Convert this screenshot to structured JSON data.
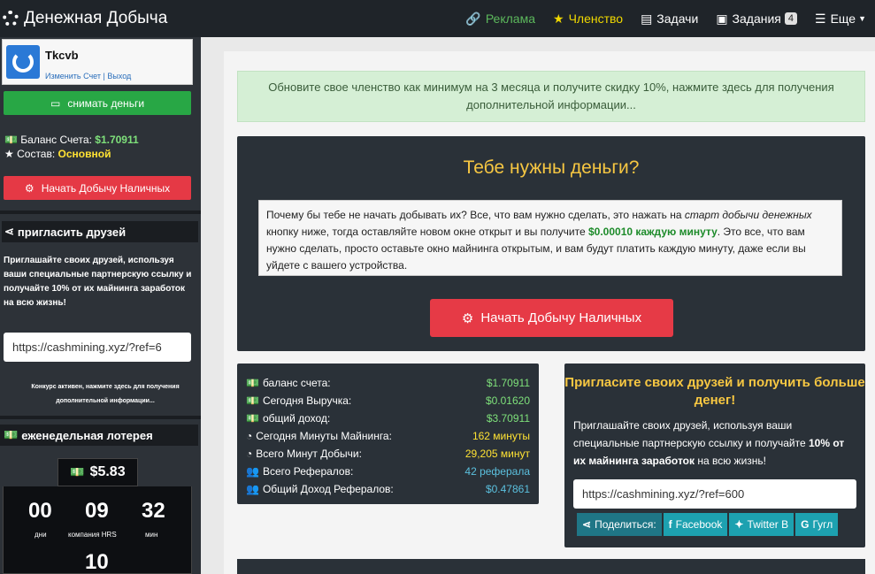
{
  "app": {
    "title": "Денежная Добыча"
  },
  "nav": {
    "ads": "Реклама",
    "membership": "Членство",
    "tasks": "Задачи",
    "jobs": "Задания",
    "jobs_count": "4",
    "more": "Еще"
  },
  "colors": {
    "green": "#28a745",
    "red": "#e53945",
    "gold": "#f7c742",
    "dark": "#2a3138"
  },
  "sidebar": {
    "username": "Tkcvb",
    "links": "Изменить Счет | Выход",
    "withdraw": "снимать деньги",
    "balance_label": "Баланс Счета:",
    "balance_value": "$1.70911",
    "status_label": "Состав:",
    "status_value": "Основной",
    "start_button": "Начать Добычу Наличных",
    "invite_title": "пригласить друзей",
    "invite_text_1": "Приглашайте своих друзей, используя ваши специальные партнерскую ссылку и получайте ",
    "invite_text_bold": "10% от их майнинга заработок",
    "invite_text_2": " на всю жизнь!",
    "ref_link": "https://cashmining.xyz/?ref=6",
    "contest": "Конкурс активен, нажмите здесь для получения дополнительной информации...",
    "lottery_title": "еженедельная лотерея",
    "jackpot": "$5.83",
    "countdown": {
      "days": "00",
      "days_label": "дни",
      "hours": "09",
      "hours_label": "компания HRS",
      "minutes": "32",
      "minutes_label": "мин",
      "seconds": "10"
    }
  },
  "main": {
    "alert": "Обновите свое членство как минимум на 3 месяца и получите скидку 10%, нажмите здесь для получения дополнительной информации...",
    "hero_title": "Тебе нужны деньги?",
    "hero_text_1": "Почему бы тебе не начать добывать их? Все, что вам нужно сделать, это нажать на ",
    "hero_text_italic": "старт добычи денежных",
    "hero_text_2": " кнопку ниже, тогда оставляйте новом окне открыт и вы получите ",
    "hero_text_green": "$0.00010 каждую минуту",
    "hero_text_3": ". Это все, что вам нужно сделать, просто оставьте окно майнинга открытым, и вам будут платить каждую минуту, даже если вы уйдете с вашего устройства.",
    "hero_button": "Начать Добычу Наличных",
    "stats": [
      {
        "label": "баланс счета:",
        "value": "$1.70911",
        "color": "#7ee07a"
      },
      {
        "label": "Сегодня Выручка:",
        "value": "$0.01620",
        "color": "#7ee07a"
      },
      {
        "label": "общий доход:",
        "value": "$3.70911",
        "color": "#7ee07a"
      },
      {
        "label": "Сегодня Минуты Майнинга:",
        "value": "162 минуты",
        "color": "#ffe233"
      },
      {
        "label": "Всего Минут Добычи:",
        "value": "29,205 минут",
        "color": "#ffe233"
      },
      {
        "label": "Всего Рефералов:",
        "value": "42 реферала",
        "color": "#5bc0de"
      },
      {
        "label": "Общий Доход Рефералов:",
        "value": "$0.47861",
        "color": "#5bc0de"
      }
    ],
    "invite_title": "Пригласите своих друзей и получить больше денег!",
    "invite_text_1": "Приглашайте своих друзей, используя ваши специальные партнерскую ссылку и получайте ",
    "invite_text_bold": "10% от их майнинга заработок",
    "invite_text_2": " на всю жизнь!",
    "ref_link": "https://cashmining.xyz/?ref=600",
    "share_label": "Поделиться:",
    "facebook": "Facebook",
    "twitter": "Twitter В",
    "google": "Гугл"
  }
}
